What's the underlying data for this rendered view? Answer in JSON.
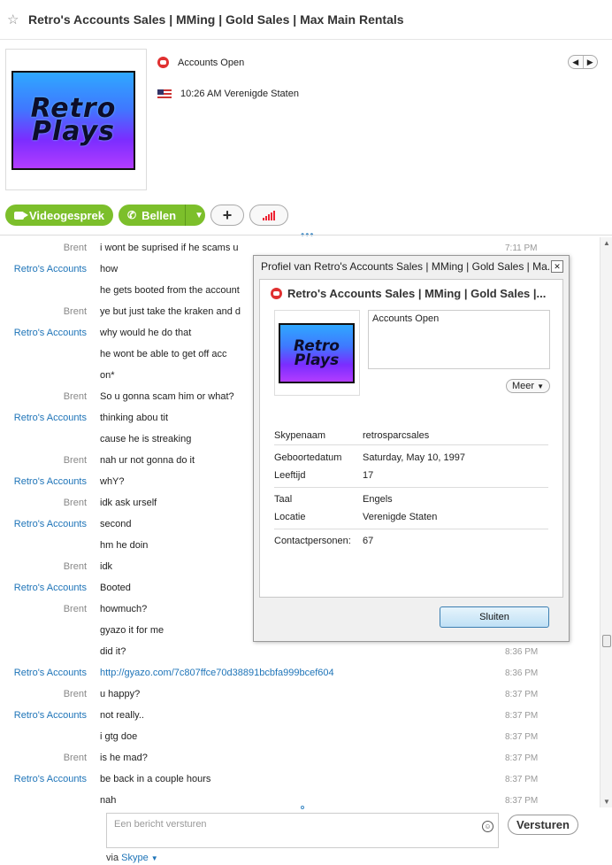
{
  "header": {
    "title": "Retro's Accounts Sales | MMing | Gold Sales | Max Main Rentals",
    "mood": "Accounts Open",
    "local_time": "10:26 AM Verenigde Staten",
    "logo_line1": "Retro",
    "logo_line2": "Plays"
  },
  "actions": {
    "video_label": "Videogesprek",
    "call_label": "Bellen"
  },
  "conversation": [
    {
      "sender": "Brent",
      "text": "i wont be suprised if he scams u",
      "time": "7:11 PM",
      "me": false
    },
    {
      "sender": "Retro's Accounts",
      "text": "how",
      "time": "",
      "me": true
    },
    {
      "sender": "",
      "text": "he gets booted from the account",
      "time": "",
      "me": true
    },
    {
      "sender": "Brent",
      "text": "ye but just take the kraken and d",
      "time": "",
      "me": false
    },
    {
      "sender": "Retro's Accounts",
      "text": "why would he do that",
      "time": "",
      "me": true
    },
    {
      "sender": "",
      "text": "he wont be able to get off acc",
      "time": "",
      "me": true
    },
    {
      "sender": "",
      "text": "on*",
      "time": "",
      "me": true
    },
    {
      "sender": "Brent",
      "text": "So u gonna scam him or what?",
      "time": "",
      "me": false
    },
    {
      "sender": "Retro's Accounts",
      "text": "thinking abou tit",
      "time": "",
      "me": true
    },
    {
      "sender": "",
      "text": "cause he is streaking",
      "time": "",
      "me": true
    },
    {
      "sender": "Brent",
      "text": "nah ur not gonna do it",
      "time": "",
      "me": false
    },
    {
      "sender": "Retro's Accounts",
      "text": "whY?",
      "time": "",
      "me": true
    },
    {
      "sender": "Brent",
      "text": "idk ask urself",
      "time": "",
      "me": false
    },
    {
      "sender": "Retro's Accounts",
      "text": "second",
      "time": "",
      "me": true
    },
    {
      "sender": "",
      "text": "hm he doin",
      "time": "",
      "me": true
    },
    {
      "sender": "Brent",
      "text": "idk",
      "time": "",
      "me": false
    },
    {
      "sender": "Retro's Accounts",
      "text": "Booted",
      "time": "",
      "me": true
    },
    {
      "sender": "Brent",
      "text": "howmuch?",
      "time": "",
      "me": false
    },
    {
      "sender": "",
      "text": "gyazo it for me",
      "time": "",
      "me": false
    },
    {
      "sender": "",
      "text": "did it?",
      "time": "8:36 PM",
      "me": false
    },
    {
      "sender": "Retro's Accounts",
      "text": "http://gyazo.com/7c807ffce70d38891bcbfa999bcef604",
      "time": "8:36 PM",
      "me": true,
      "link": true
    },
    {
      "sender": "Brent",
      "text": "u happy?",
      "time": "8:37 PM",
      "me": false
    },
    {
      "sender": "Retro's Accounts",
      "text": "not really..",
      "time": "8:37 PM",
      "me": true
    },
    {
      "sender": "",
      "text": "i gtg doe",
      "time": "8:37 PM",
      "me": true
    },
    {
      "sender": "Brent",
      "text": "is he mad?",
      "time": "8:37 PM",
      "me": false
    },
    {
      "sender": "Retro's Accounts",
      "text": "be back in a couple hours",
      "time": "8:37 PM",
      "me": true
    },
    {
      "sender": "",
      "text": "nah",
      "time": "8:37 PM",
      "me": true
    }
  ],
  "composer": {
    "placeholder": "Een bericht versturen",
    "send_label": "Versturen",
    "via_prefix": "via",
    "via_service": "Skype"
  },
  "profile_dialog": {
    "window_title": "Profiel van Retro's Accounts Sales | MMing | Gold Sales | Ma...",
    "name": "Retro's Accounts Sales | MMing | Gold Sales |...",
    "mood": "Accounts Open",
    "more_label": "Meer",
    "fields": [
      {
        "label": "Skypenaam",
        "value": "retrosparcsales"
      },
      {
        "label": "Geboortedatum",
        "value": "Saturday, May 10, 1997"
      },
      {
        "label": "Leeftijd",
        "value": "17"
      },
      {
        "label": "Taal",
        "value": "Engels"
      },
      {
        "label": "Locatie",
        "value": "Verenigde Staten"
      },
      {
        "label": "Contactpersonen:",
        "value": "67"
      }
    ],
    "close_label": "Sluiten"
  }
}
